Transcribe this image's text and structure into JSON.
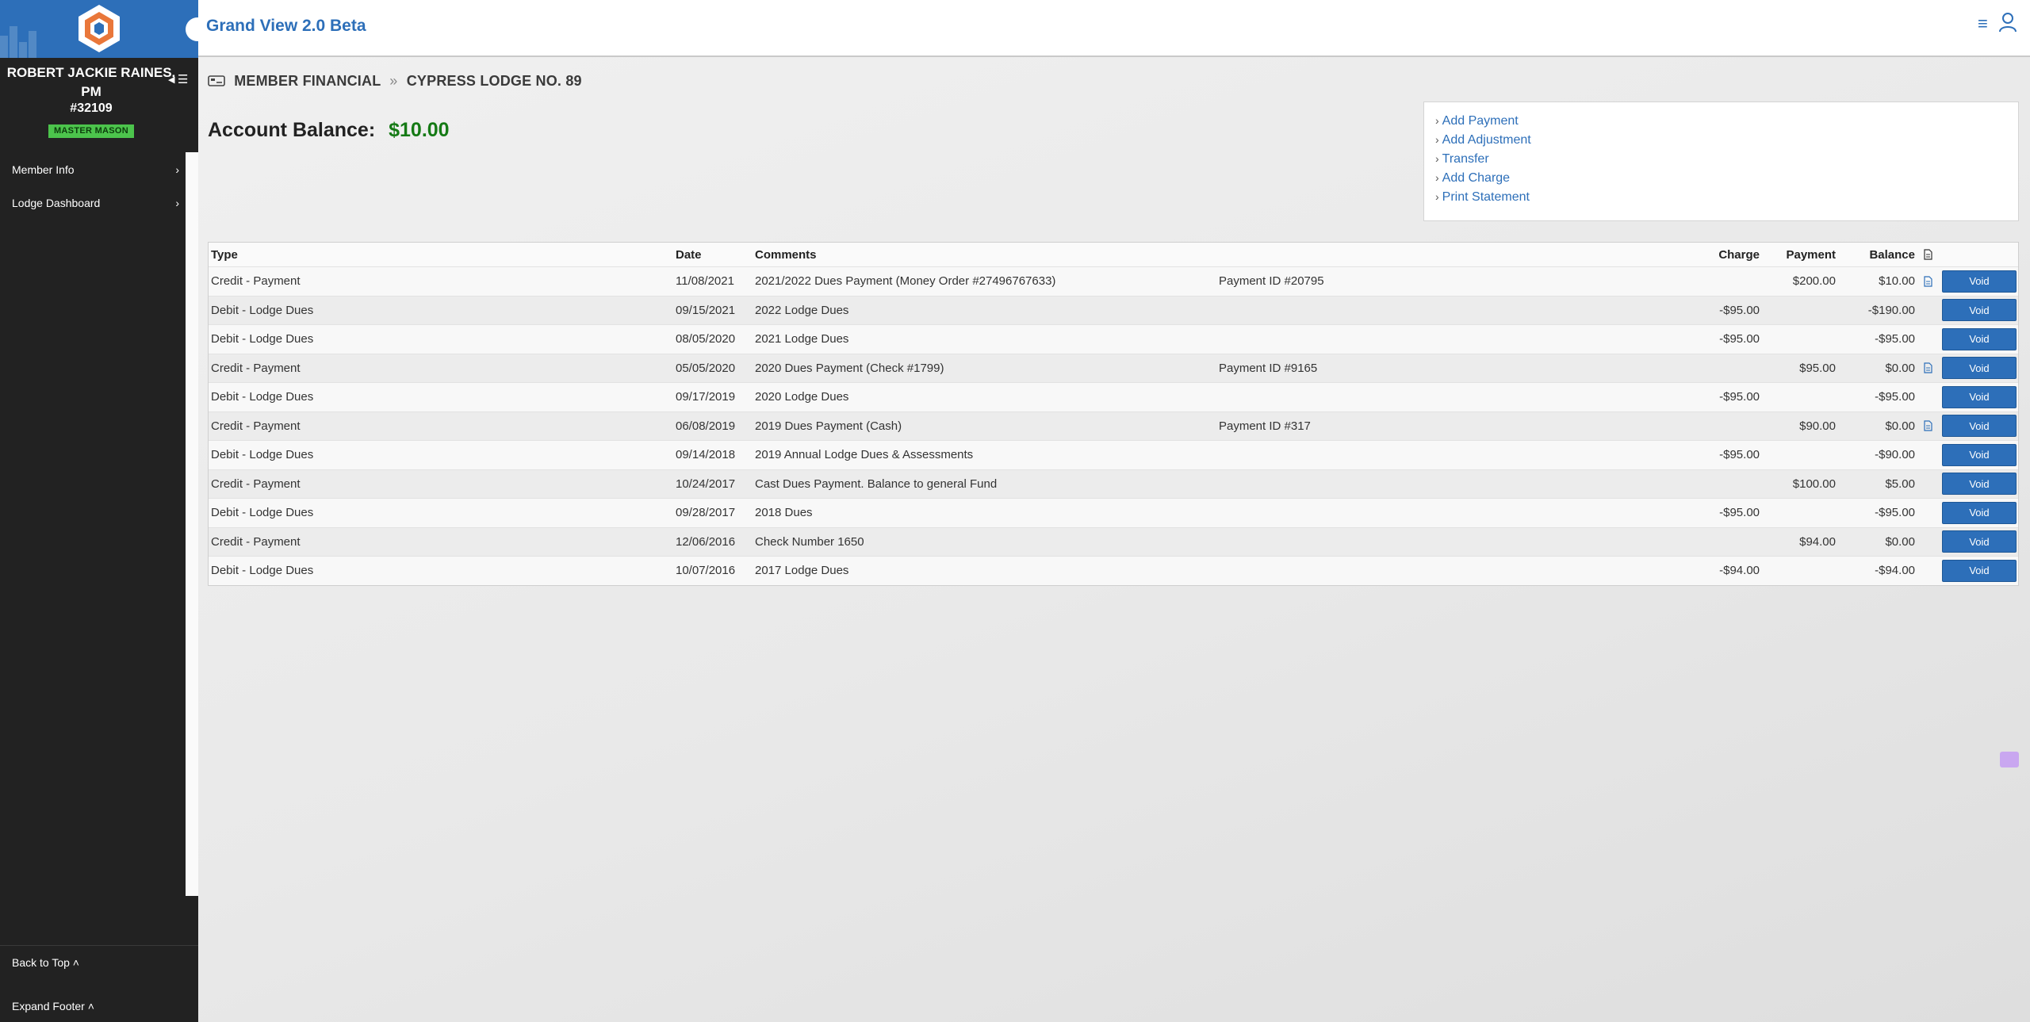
{
  "app": {
    "title": "Grand View 2.0 Beta"
  },
  "sidebar": {
    "member_name": "ROBERT JACKIE RAINES, PM",
    "member_number": "#32109",
    "member_badge": "MASTER MASON",
    "nav": [
      {
        "label": "Member Info"
      },
      {
        "label": "Lodge Dashboard"
      }
    ],
    "footer": {
      "back_to_top": "Back to Top",
      "expand_footer": "Expand Footer"
    }
  },
  "breadcrumb": {
    "section": "MEMBER FINANCIAL",
    "lodge": "CYPRESS LODGE NO. 89"
  },
  "balance": {
    "label": "Account Balance:",
    "amount": "$10.00"
  },
  "actions": [
    {
      "label": "Add Payment"
    },
    {
      "label": "Add Adjustment"
    },
    {
      "label": "Transfer"
    },
    {
      "label": "Add Charge"
    },
    {
      "label": "Print Statement"
    }
  ],
  "table": {
    "headers": {
      "type": "Type",
      "date": "Date",
      "comments": "Comments",
      "charge": "Charge",
      "payment": "Payment",
      "balance": "Balance"
    },
    "void_label": "Void",
    "rows": [
      {
        "type": "Credit - Payment",
        "date": "11/08/2021",
        "comments": "2021/2022 Dues Payment (Money Order #27496767633)",
        "ref": "Payment ID #20795",
        "charge": "",
        "payment": "$200.00",
        "balance": "$10.00",
        "has_doc": true
      },
      {
        "type": "Debit - Lodge Dues",
        "date": "09/15/2021",
        "comments": "2022 Lodge Dues",
        "ref": "",
        "charge": "-$95.00",
        "payment": "",
        "balance": "-$190.00",
        "has_doc": false
      },
      {
        "type": "Debit - Lodge Dues",
        "date": "08/05/2020",
        "comments": "2021 Lodge Dues",
        "ref": "",
        "charge": "-$95.00",
        "payment": "",
        "balance": "-$95.00",
        "has_doc": false
      },
      {
        "type": "Credit - Payment",
        "date": "05/05/2020",
        "comments": "2020 Dues Payment (Check #1799)",
        "ref": "Payment ID #9165",
        "charge": "",
        "payment": "$95.00",
        "balance": "$0.00",
        "has_doc": true
      },
      {
        "type": "Debit - Lodge Dues",
        "date": "09/17/2019",
        "comments": "2020 Lodge Dues",
        "ref": "",
        "charge": "-$95.00",
        "payment": "",
        "balance": "-$95.00",
        "has_doc": false
      },
      {
        "type": "Credit - Payment",
        "date": "06/08/2019",
        "comments": "2019 Dues Payment (Cash)",
        "ref": "Payment ID #317",
        "charge": "",
        "payment": "$90.00",
        "balance": "$0.00",
        "has_doc": true
      },
      {
        "type": "Debit - Lodge Dues",
        "date": "09/14/2018",
        "comments": "2019 Annual Lodge Dues & Assessments",
        "ref": "",
        "charge": "-$95.00",
        "payment": "",
        "balance": "-$90.00",
        "has_doc": false
      },
      {
        "type": "Credit - Payment",
        "date": "10/24/2017",
        "comments": "Cast Dues Payment. Balance to general Fund",
        "ref": "",
        "charge": "",
        "payment": "$100.00",
        "balance": "$5.00",
        "has_doc": false
      },
      {
        "type": "Debit - Lodge Dues",
        "date": "09/28/2017",
        "comments": "2018 Dues",
        "ref": "",
        "charge": "-$95.00",
        "payment": "",
        "balance": "-$95.00",
        "has_doc": false
      },
      {
        "type": "Credit - Payment",
        "date": "12/06/2016",
        "comments": "Check Number 1650",
        "ref": "",
        "charge": "",
        "payment": "$94.00",
        "balance": "$0.00",
        "has_doc": false
      },
      {
        "type": "Debit - Lodge Dues",
        "date": "10/07/2016",
        "comments": "2017 Lodge Dues",
        "ref": "",
        "charge": "-$94.00",
        "payment": "",
        "balance": "-$94.00",
        "has_doc": false
      }
    ]
  },
  "icons": {
    "logo": "hexagon-logo-icon",
    "menu": "hamburger-icon",
    "user": "user-icon",
    "breadcrumb": "money-card-icon",
    "document": "document-icon",
    "chevron": "chevron-right-icon"
  },
  "colors": {
    "brand_blue": "#2d6fb9",
    "sidebar_bg": "#222222",
    "balance_green": "#157a15",
    "badge_green": "#4cc44c"
  }
}
